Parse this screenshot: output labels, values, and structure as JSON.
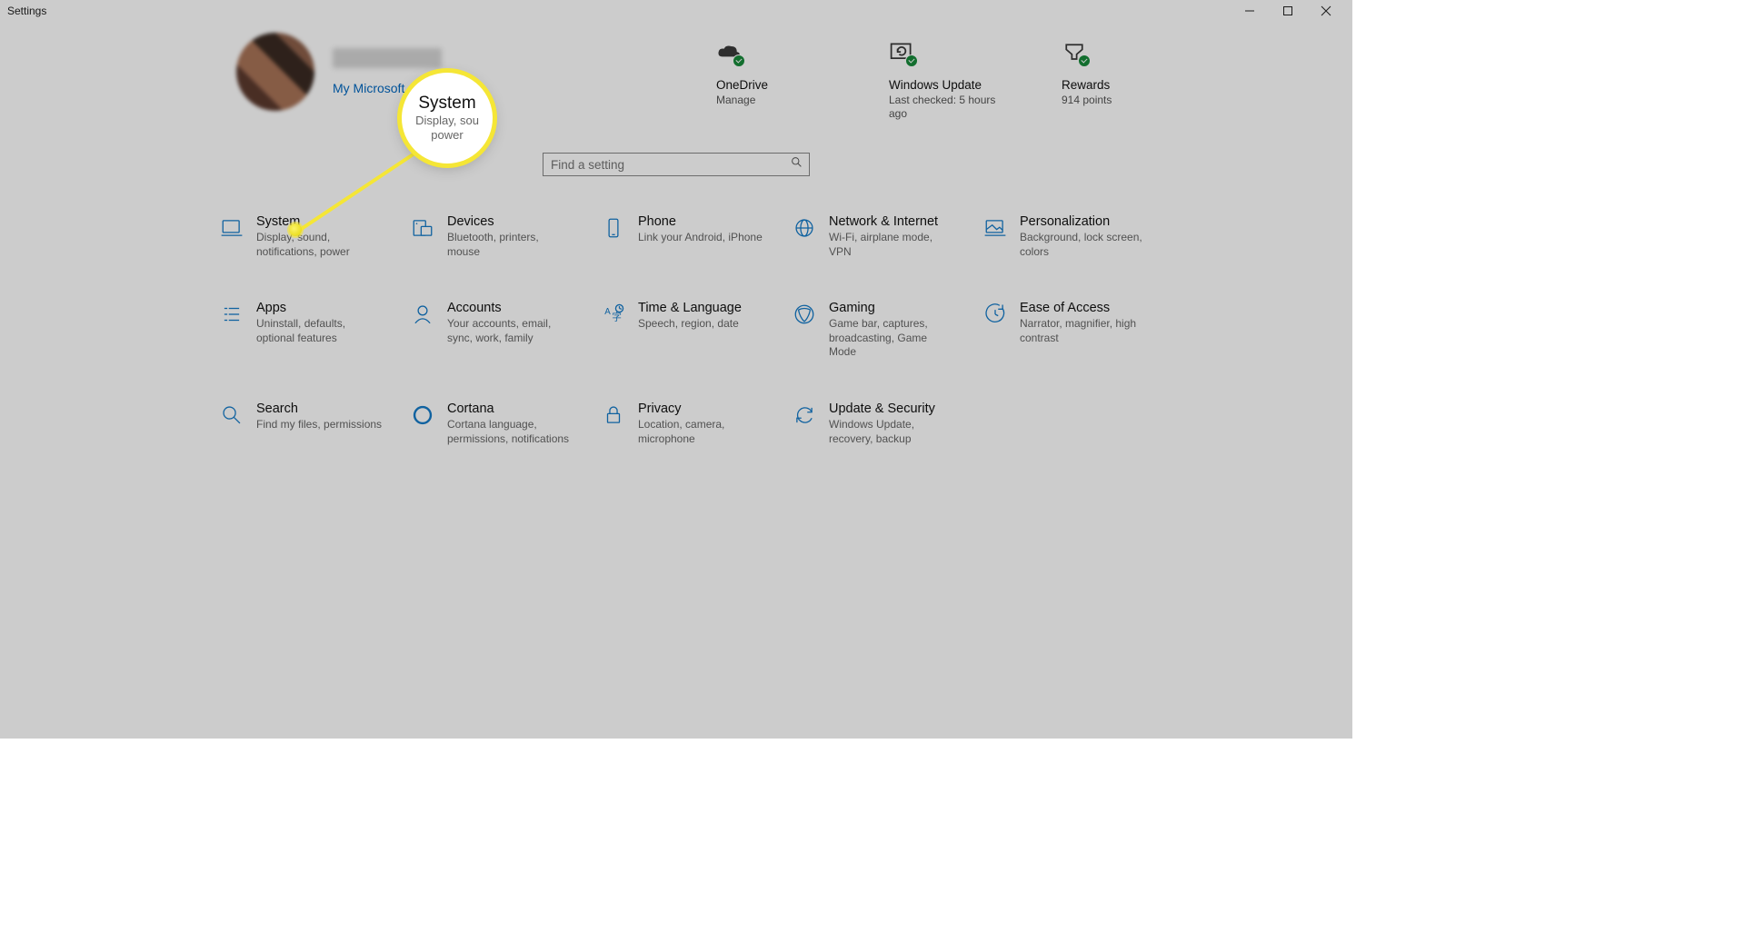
{
  "window": {
    "title": "Settings"
  },
  "account_link": "My Microsoft Account",
  "status": {
    "onedrive": {
      "name": "OneDrive",
      "sub": "Manage"
    },
    "update": {
      "name": "Windows Update",
      "sub": "Last checked: 5 hours ago"
    },
    "rewards": {
      "name": "Rewards",
      "sub": "914 points"
    }
  },
  "search": {
    "placeholder": "Find a setting"
  },
  "categories": [
    {
      "title": "System",
      "desc": "Display, sound, notifications, power"
    },
    {
      "title": "Devices",
      "desc": "Bluetooth, printers, mouse"
    },
    {
      "title": "Phone",
      "desc": "Link your Android, iPhone"
    },
    {
      "title": "Network & Internet",
      "desc": "Wi-Fi, airplane mode, VPN"
    },
    {
      "title": "Personalization",
      "desc": "Background, lock screen, colors"
    },
    {
      "title": "Apps",
      "desc": "Uninstall, defaults, optional features"
    },
    {
      "title": "Accounts",
      "desc": "Your accounts, email, sync, work, family"
    },
    {
      "title": "Time & Language",
      "desc": "Speech, region, date"
    },
    {
      "title": "Gaming",
      "desc": "Game bar, captures, broadcasting, Game Mode"
    },
    {
      "title": "Ease of Access",
      "desc": "Narrator, magnifier, high contrast"
    },
    {
      "title": "Search",
      "desc": "Find my files, permissions"
    },
    {
      "title": "Cortana",
      "desc": "Cortana language, permissions, notifications"
    },
    {
      "title": "Privacy",
      "desc": "Location, camera, microphone"
    },
    {
      "title": "Update & Security",
      "desc": "Windows Update, recovery, backup"
    }
  ],
  "callout": {
    "title": "System",
    "sub": "Display, sou power"
  }
}
